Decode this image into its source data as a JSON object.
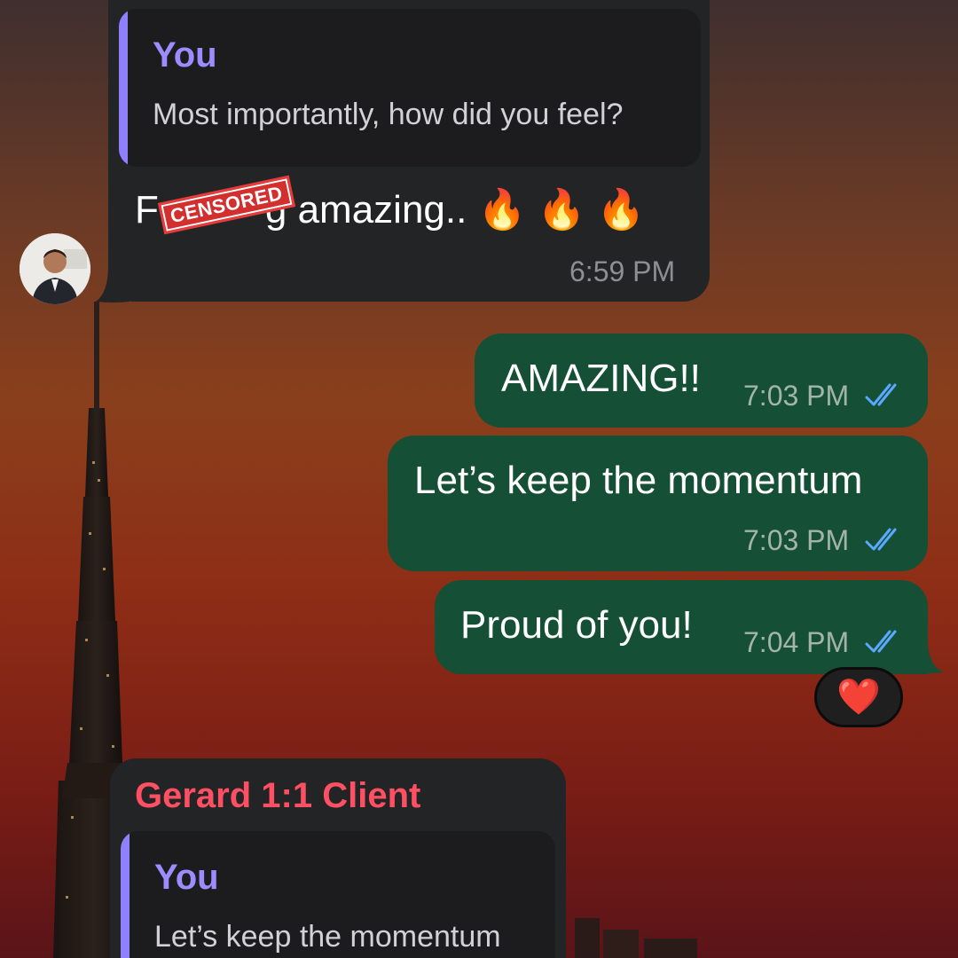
{
  "messages": {
    "incoming_1": {
      "quote_author": "You",
      "quote_text": "Most importantly, how did you feel?",
      "text_start": "F",
      "text_mid": "g amazing.. ",
      "censor_label": "CENSORED",
      "emojis": "🔥 🔥 🔥",
      "time": "6:59 PM"
    },
    "outgoing_1": {
      "text": "AMAZING!!",
      "time": "7:03 PM"
    },
    "outgoing_2": {
      "text": "Let’s keep the momentum",
      "time": "7:03 PM"
    },
    "outgoing_3": {
      "text": "Proud of you!",
      "time": "7:04 PM",
      "reaction": "❤️"
    },
    "incoming_2": {
      "sender": "Gerard 1:1 Client",
      "quote_author": "You",
      "quote_text": "Let’s keep the momentum"
    }
  },
  "colors": {
    "incoming_bubble": "#232426",
    "outgoing_bubble": "#154f36",
    "quote_accent": "#8f80ff",
    "sender_name": "#ff4f62",
    "read_ticks": "#5aa8ff"
  },
  "icons": {
    "read_status": "double-check-icon",
    "avatar": "user-avatar"
  }
}
